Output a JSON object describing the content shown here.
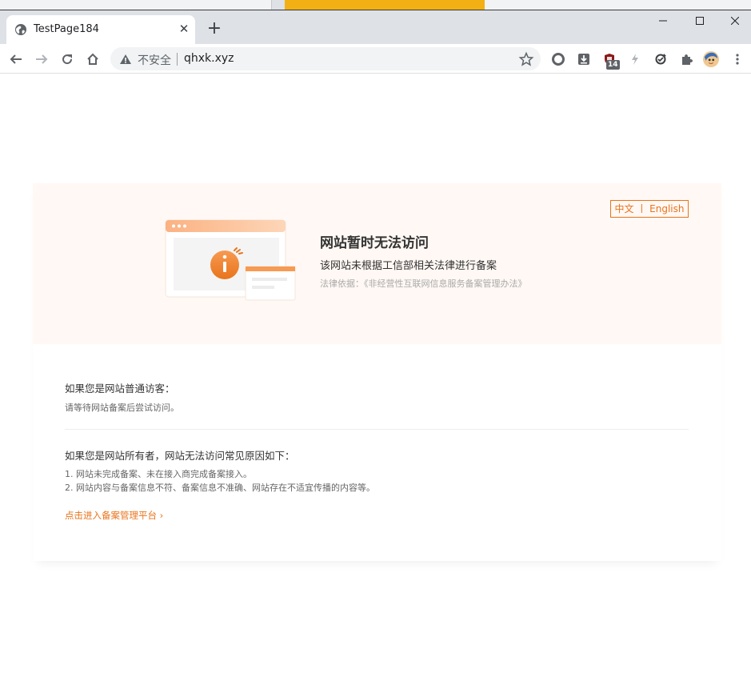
{
  "browser": {
    "tab_title": "TestPage184",
    "tab_close": "✕",
    "new_tab": "+",
    "security_label": "不安全",
    "url": "qhxk.xyz",
    "extension_badge": "14"
  },
  "notice": {
    "lang_zh": "中文",
    "lang_sep": "丨",
    "lang_en": "English",
    "title": "网站暂时无法访问",
    "subtitle": "该网站未根据工信部相关法律进行备案",
    "law_basis": "法律依据：《非经营性互联网信息服务备案管理办法》"
  },
  "visitor": {
    "heading": "如果您是网站普通访客：",
    "text": "请等待网站备案后尝试访问。"
  },
  "owner": {
    "heading": "如果您是网站所有者，网站无法访问常见原因如下：",
    "reasons": [
      "1. 网站未完成备案、未在接入商完成备案接入。",
      "2. 网站内容与备案信息不符、备案信息不准确、网站存在不适宜传播的内容等。"
    ],
    "link": "点击进入备案管理平台 ›"
  },
  "colors": {
    "accent": "#e8741c",
    "hero_bg": "#fff8f4",
    "tab_strip_accent": "#f3b014"
  }
}
